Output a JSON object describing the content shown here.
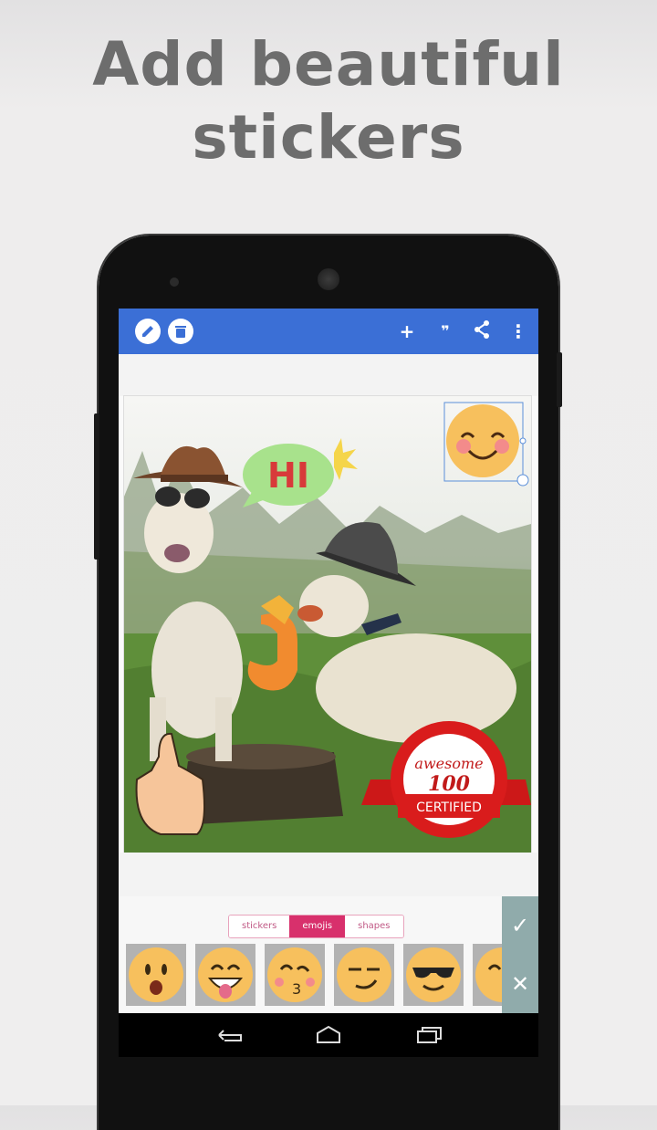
{
  "headline": {
    "line1": "Add beautiful",
    "line2": "stickers"
  },
  "toolbar": {
    "left_icons": [
      "pencil-icon",
      "trash-icon"
    ],
    "right_icons": [
      "plus-icon",
      "quote-icon",
      "share-icon",
      "more-vert-icon"
    ],
    "plus_label": "+",
    "quote_label": "❞",
    "more_label": "⋮"
  },
  "stickers": {
    "speech_bubble_text": "HI",
    "badge_top": "awesome",
    "badge_number": "100",
    "badge_bottom": "CERTIFIED"
  },
  "tabs": [
    {
      "label": "stickers",
      "active": false
    },
    {
      "label": "emojis",
      "active": true
    },
    {
      "label": "shapes",
      "active": false
    }
  ],
  "emoji_palette": [
    "surprised-face-icon",
    "tongue-out-face-icon",
    "kissing-face-icon",
    "smirk-face-icon",
    "sunglasses-face-icon",
    "partial-face-icon"
  ],
  "actions": {
    "confirm": "✓",
    "cancel": "✕"
  },
  "navbar": [
    "back-icon",
    "home-icon",
    "recents-icon"
  ],
  "colors": {
    "appbar": "#3b6fd6",
    "tab_active": "#d8306c",
    "sidebar": "#90abab",
    "headline": "#6d6d6d"
  }
}
